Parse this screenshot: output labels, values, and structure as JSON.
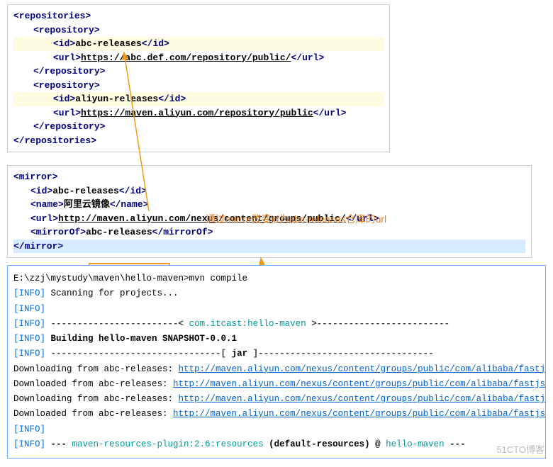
{
  "repositories": {
    "open": "<repositories>",
    "close": "</repositories>",
    "repo_open": "<repository>",
    "repo_close": "</repository>",
    "id1_open": "<id>",
    "id1_text": "abc-releases",
    "id1_close": "</id>",
    "url1_open": "<url>",
    "url1_text": "https://abc.def.com/repository/public/",
    "url1_close": "</url>",
    "id2_text": "aliyun-releases",
    "url2_text": "https://maven.aliyun.com/repository/public"
  },
  "mirror": {
    "open": "<mirror>",
    "close": "</mirror>",
    "id_open": "<id>",
    "id_text": "abc-releases",
    "id_close": "</id>",
    "name_open": "<name>",
    "name_text": "阿里云镜像",
    "name_close": "</name>",
    "url_open": "<url>",
    "url_text": "http://maven.aliyun.com/nexus/content/groups/public/",
    "url_close": "</url>",
    "mirrorof_open": "<mirrorOf>",
    "mirrorof_text": "abc-releases",
    "mirrorof_close": "</mirrorOf>"
  },
  "annotation": {
    "text": "通过mirror改变id为abc-releases仓库的url"
  },
  "console": {
    "cmd": "E:\\zzj\\mystudy\\maven\\hello-maven>mvn compile",
    "info_label": "[INFO]",
    "scanning": " Scanning for projects...",
    "blank": "",
    "sep_left": " ------------------------< ",
    "artifact": "com.itcast:hello-maven",
    "sep_right": " >-------------------------",
    "building": " Building hello-maven SNAPSHOT-0.0.1",
    "jar_left": " --------------------------------[ ",
    "jar": "jar",
    "jar_right": " ]---------------------------------",
    "dl_from": "Downloading from abc-releases: ",
    "dl_done": "Downloaded from abc-releases: ",
    "url1": "http://maven.aliyun.com/nexus/content/groups/public/com/alibaba/fastjson",
    "url2": "http://maven.aliyun.com/nexus/content/groups/public/com/alibaba/fastjson/",
    "url3": "http://maven.aliyun.com/nexus/content/groups/public/com/alibaba/fastjson",
    "url4": "http://maven.aliyun.com/nexus/content/groups/public/com/alibaba/fastjson/",
    "plugin_pre": " --- ",
    "plugin": "maven-resources-plugin:2.6:resources",
    "plugin_mid": " (default-resources) @ ",
    "plugin_proj": "hello-maven",
    "plugin_end": " ---"
  },
  "watermark": "51CTO博客"
}
